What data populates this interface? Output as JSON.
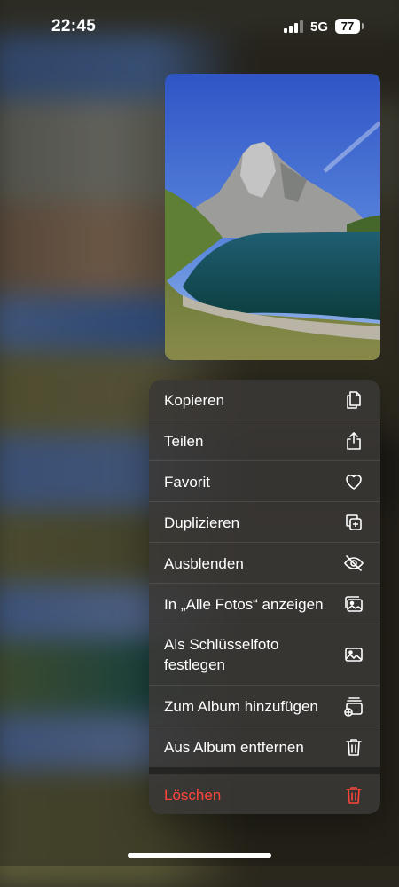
{
  "status_bar": {
    "time": "22:45",
    "network": "5G",
    "battery": "77",
    "icons": [
      "signal-icon",
      "battery-icon"
    ]
  },
  "preview": {
    "icon": "mountain-lake-photo"
  },
  "menu": {
    "items": [
      {
        "label": "Kopieren",
        "icon": "copy-icon"
      },
      {
        "label": "Teilen",
        "icon": "share-icon"
      },
      {
        "label": "Favorit",
        "icon": "heart-icon"
      },
      {
        "label": "Duplizieren",
        "icon": "duplicate-icon"
      },
      {
        "label": "Ausblenden",
        "icon": "eye-slash-icon"
      },
      {
        "label": "In „Alle Fotos“ anzeigen",
        "icon": "photo-stack-icon"
      },
      {
        "label": "Als Schlüsselfoto festlegen",
        "icon": "photo-icon"
      },
      {
        "label": "Zum Album hinzufügen",
        "icon": "add-to-album-icon"
      },
      {
        "label": "Aus Album entfernen",
        "icon": "trash-icon"
      }
    ],
    "delete": {
      "label": "Löschen",
      "icon": "trash-icon",
      "color": "#ff453a"
    }
  },
  "colors": {
    "menu_bg": "#3a3836",
    "destructive": "#ff453a",
    "text": "#ffffff"
  }
}
